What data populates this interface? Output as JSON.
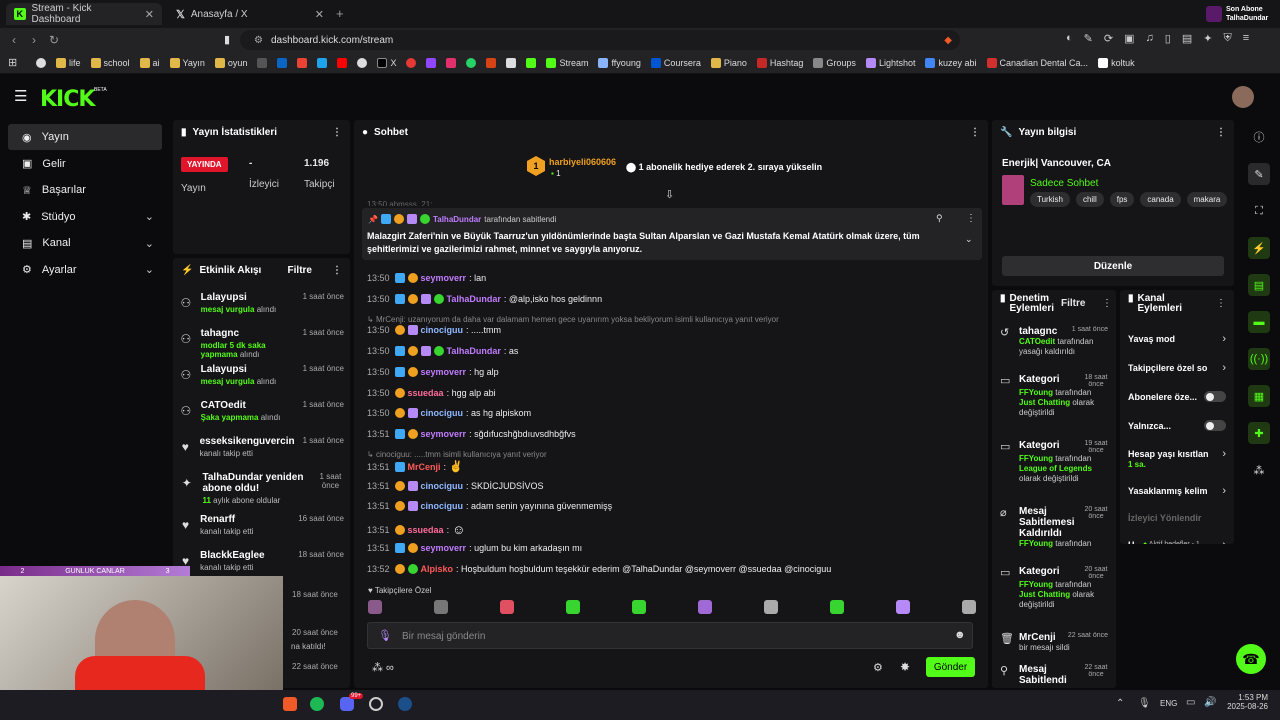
{
  "browser": {
    "tabs": [
      {
        "label": "Stream - Kick Dashboard"
      },
      {
        "label": "Anasayfa / X"
      }
    ],
    "url": "dashboard.kick.com/stream",
    "bookmarks": [
      "life",
      "school",
      "ai",
      "Yayın",
      "oyun",
      "X",
      "Stream",
      "ffyoung",
      "Coursera",
      "Piano",
      "Hashtag",
      "Groups",
      "Lightshot",
      "kuzey abi",
      "Canadian Dental Ca...",
      "koltuk"
    ],
    "notification": {
      "line1": "Son Abone",
      "line2": "TalhaDundar"
    }
  },
  "kick": {
    "logo": "KICK",
    "beta": "BETA"
  },
  "nav": [
    {
      "label": "Yayın"
    },
    {
      "label": "Gelir"
    },
    {
      "label": "Başarılar"
    },
    {
      "label": "Stüdyo"
    },
    {
      "label": "Kanal"
    },
    {
      "label": "Ayarlar"
    }
  ],
  "stats": {
    "title": "Yayın İstatistikleri",
    "live_badge": "YAYINDA",
    "live_label": "Yayın",
    "viewers_value": "-",
    "viewers_label": "İzleyici",
    "followers_value": "1.196",
    "followers_label": "Takipçi"
  },
  "activity": {
    "title": "Etkinlik Akışı",
    "filter": "Filtre",
    "events": [
      {
        "name": "Lalayupsi",
        "highlight": "mesaj vurgula",
        "rest": " alındı",
        "time": "1 saat önce"
      },
      {
        "name": "tahagnc",
        "highlight": "modlar 5 dk saka yapmama",
        "rest": " alındı",
        "time": "1 saat önce"
      },
      {
        "name": "Lalayupsi",
        "highlight": "mesaj vurgula",
        "rest": " alındı",
        "time": "1 saat önce"
      },
      {
        "name": "CATOedit",
        "highlight": "Şaka yapmama",
        "rest": " alındı",
        "time": "1 saat önce"
      },
      {
        "name": "esseksikenguvercin",
        "highlight": "",
        "rest": "kanalı takip etti",
        "time": "1 saat önce"
      },
      {
        "name": "TalhaDundar yeniden abone oldu!",
        "highlight": "11",
        "rest": " aylık abone oldular",
        "time": "1 saat önce"
      },
      {
        "name": "Renarff",
        "highlight": "",
        "rest": "kanalı takip etti",
        "time": "16 saat önce"
      },
      {
        "name": "BlackkEaglee",
        "highlight": "",
        "rest": "kanalı takip etti",
        "time": "18 saat önce"
      }
    ],
    "extra_times": [
      "18 saat önce",
      "20 saat önce",
      "22 saat önce"
    ],
    "extra_sub": "na katıldı!"
  },
  "overlay": {
    "left": "2",
    "center": "GUNLUK CANLAR",
    "right": "3"
  },
  "chat": {
    "title": "Sohbet",
    "gift_user": "harbiyeli060606",
    "gift_count": "1",
    "gift_text": "1 abonelik hediye ederek 2. sıraya yükselin",
    "partial_line": "13:50  ahmsss_21:",
    "pinned_by_user": "TalhaDundar",
    "pinned_by_text": "tarafından sabitlendi",
    "pinned_text": "Malazgirt Zaferi'nin ve Büyük Taarruz'un yıldönümlerinde başta Sultan Alparslan ve Gazi Mustafa Kemal Atatürk olmak üzere, tüm şehitlerimizi ve gazilerimizi rahmet, minnet ve saygıyla anıyoruz.",
    "messages": [
      {
        "time": "13:50",
        "user": "seymoverr",
        "color": "#c07cff",
        "text": ": lan",
        "reply": ""
      },
      {
        "time": "13:50",
        "user": "TalhaDundar",
        "color": "#c07cff",
        "text": ": @alp,isko hos geldinnn",
        "reply": ""
      },
      {
        "time": "13:50",
        "user": "cinociguu",
        "color": "#8fb8ff",
        "text": ": .....tmm",
        "reply": "MrCenji: uzanıyorum da daha var dalamam hemen gece uyanırım yoksa bekliyorum isimli kullanıcıya yanıt veriyor"
      },
      {
        "time": "13:50",
        "user": "TalhaDundar",
        "color": "#c07cff",
        "text": ": as",
        "reply": ""
      },
      {
        "time": "13:50",
        "user": "seymoverr",
        "color": "#c07cff",
        "text": ": hg alp",
        "reply": ""
      },
      {
        "time": "13:50",
        "user": "ssuedaa",
        "color": "#ff6b9a",
        "text": ": hgg alp abi",
        "reply": ""
      },
      {
        "time": "13:50",
        "user": "cinociguu",
        "color": "#8fb8ff",
        "text": ": as hg alpiskom",
        "reply": ""
      },
      {
        "time": "13:51",
        "user": "seymoverr",
        "color": "#c07cff",
        "text": ": sğdıfucshğbdıuvsdhbğfvs",
        "reply": ""
      },
      {
        "time": "13:51",
        "user": "MrCenji",
        "color": "#ff5a5a",
        "text": ":",
        "reply": "cinociguu: .....tmm isimli kullanıcıya yanıt veriyor"
      },
      {
        "time": "13:51",
        "user": "cinociguu",
        "color": "#8fb8ff",
        "text": ": SKDİCJUDSİVOS",
        "reply": ""
      },
      {
        "time": "13:51",
        "user": "cinociguu",
        "color": "#8fb8ff",
        "text": ": adam senin yayınına güvenmemişş",
        "reply": ""
      },
      {
        "time": "13:51",
        "user": "ssuedaa",
        "color": "#ff6b9a",
        "text": ":",
        "reply": ""
      },
      {
        "time": "13:51",
        "user": "seymoverr",
        "color": "#c07cff",
        "text": ": uglum bu kim arkadaşın mı",
        "reply": ""
      },
      {
        "time": "13:52",
        "user": "Alpisko",
        "color": "#ff5a5a",
        "text": ": Hoşbuldum hoşbuldum teşekkür ederim @TalhaDundar @seymoverr @ssuedaa @cinociguu",
        "reply": ""
      }
    ],
    "followers_only": "Takipçilere Özel",
    "input_placeholder": "Bir mesaj gönderin",
    "send": "Gönder"
  },
  "stream_info": {
    "title": "Yayın bilgisi",
    "stream_title": "Enerjik| Vancouver, CA",
    "category": "Sadece Sohbet",
    "tags": [
      "Turkish",
      "chill",
      "fps",
      "canada",
      "makara"
    ],
    "edit": "Düzenle"
  },
  "mod_actions": {
    "title": "Denetim Eylemleri",
    "filter": "Filtre",
    "items": [
      {
        "name": "tahagnc",
        "time": "1 saat önce",
        "lines": [
          {
            "hl": "CATOedit",
            "rest": " tarafından"
          },
          {
            "hl": "",
            "rest": "yasağı kaldırıldı"
          }
        ]
      },
      {
        "name": "Kategori",
        "time": "18 saat önce",
        "lines": [
          {
            "hl": "FFYoung",
            "rest": " tarafından"
          },
          {
            "hl": "Just Chatting",
            "rest": " olarak"
          },
          {
            "hl": "",
            "rest": "değiştirildi"
          }
        ]
      },
      {
        "name": "Kategori",
        "time": "19 saat önce",
        "lines": [
          {
            "hl": "FFYoung",
            "rest": " tarafından"
          },
          {
            "hl": "League of Legends",
            "rest": ""
          },
          {
            "hl": "",
            "rest": "olarak değiştirildi"
          }
        ]
      },
      {
        "name": "Mesaj Sabitlemesi Kaldırıldı",
        "time": "20 saat önce",
        "lines": [
          {
            "hl": "FFYoung",
            "rest": " tarafından"
          }
        ]
      },
      {
        "name": "Kategori",
        "time": "20 saat önce",
        "lines": [
          {
            "hl": "FFYoung",
            "rest": " tarafından"
          },
          {
            "hl": "Just Chatting",
            "rest": " olarak"
          },
          {
            "hl": "",
            "rest": "değiştirildi"
          }
        ]
      },
      {
        "name": "MrCenji",
        "time": "22 saat önce",
        "lines": [
          {
            "hl": "",
            "rest": "bir mesajı sildi"
          }
        ]
      },
      {
        "name": "Mesaj Sabitlendi",
        "time": "22 saat önce",
        "lines": []
      }
    ]
  },
  "channel_actions": {
    "title": "Kanal Eylemleri",
    "items": [
      {
        "label": "Yavaş mod",
        "type": "chevron"
      },
      {
        "label": "Takipçilere özel so",
        "type": "chevron"
      },
      {
        "label": "Abonelere öze...",
        "type": "toggle"
      },
      {
        "label": "Yalnızca...",
        "type": "toggle"
      },
      {
        "label": "Hesap yaşı kısıtlan",
        "type": "chevron",
        "sub": "1 sa."
      },
      {
        "label": "Yasaklanmış kelim",
        "type": "chevron"
      },
      {
        "label": "İzleyici Yönlendir",
        "type": "disabled"
      },
      {
        "label": "H.",
        "type": "chevron",
        "sub2": "Aktif hedefler - 1"
      }
    ]
  },
  "taskbar": {
    "lang": "ENG",
    "time": "1:53 PM",
    "date": "2025-08-26",
    "badge": "99+"
  }
}
